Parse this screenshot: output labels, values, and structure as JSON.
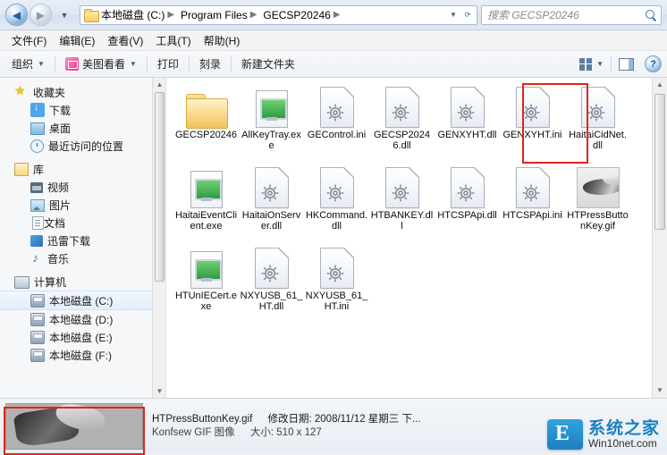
{
  "titlebar": {
    "back_icon": "back-arrow-icon",
    "forward_icon": "forward-arrow-icon",
    "recent_icon": "recent-pages-icon",
    "breadcrumb": [
      "本地磁盘 (C:)",
      "Program Files",
      "GECSP20246"
    ],
    "breadcrumb_separator": "▶",
    "address_dropdown_icon": "chevron-down-icon",
    "refresh_icon": "refresh-icon",
    "search_placeholder": "搜索 GECSP20246",
    "search_value": "",
    "search_icon": "search-icon"
  },
  "menubar": {
    "items": [
      "文件(F)",
      "编辑(E)",
      "查看(V)",
      "工具(T)",
      "帮助(H)"
    ]
  },
  "toolbar": {
    "organize": "组织",
    "meitu": "美图看看",
    "print": "打印",
    "burn": "刻录",
    "new_folder": "新建文件夹",
    "view_icon": "view-layout-icon",
    "preview_pane_icon": "preview-pane-icon",
    "help_icon": "help-icon",
    "caret": "▼"
  },
  "sidebar": {
    "groups": [
      {
        "title": "收藏夹",
        "icon": "favorites-star-icon",
        "items": [
          {
            "label": "下载",
            "icon": "downloads-icon"
          },
          {
            "label": "桌面",
            "icon": "desktop-icon"
          },
          {
            "label": "最近访问的位置",
            "icon": "recent-places-icon"
          }
        ]
      },
      {
        "title": "库",
        "icon": "library-icon",
        "items": [
          {
            "label": "视频",
            "icon": "videos-icon"
          },
          {
            "label": "图片",
            "icon": "pictures-icon"
          },
          {
            "label": "文档",
            "icon": "documents-icon"
          },
          {
            "label": "迅雷下载",
            "icon": "thunder-download-icon"
          },
          {
            "label": "音乐",
            "icon": "music-icon"
          }
        ]
      },
      {
        "title": "计算机",
        "icon": "computer-icon",
        "items": [
          {
            "label": "本地磁盘 (C:)",
            "icon": "disk-icon",
            "selected": true
          },
          {
            "label": "本地磁盘 (D:)",
            "icon": "disk-icon",
            "selected": false
          },
          {
            "label": "本地磁盘 (E:)",
            "icon": "disk-icon",
            "selected": false
          },
          {
            "label": "本地磁盘 (F:)",
            "icon": "disk-icon",
            "selected": false
          }
        ]
      }
    ]
  },
  "files": [
    {
      "name": "GECSP20246",
      "type": "folder",
      "selected": false
    },
    {
      "name": "AllKeyTray.exe",
      "type": "exe",
      "selected": false
    },
    {
      "name": "GEControl.ini",
      "type": "ini",
      "selected": false
    },
    {
      "name": "GECSP20246.dll",
      "type": "dll",
      "selected": false
    },
    {
      "name": "GENXYHT.dll",
      "type": "dll",
      "selected": false
    },
    {
      "name": "GENXYHT.ini",
      "type": "ini",
      "selected": false
    },
    {
      "name": "HaitaiCidNet.dll",
      "type": "dll",
      "selected": false
    },
    {
      "name": "HaitaiEventClient.exe",
      "type": "exe",
      "selected": false
    },
    {
      "name": "HaitaiOnServer.dll",
      "type": "dll",
      "selected": false
    },
    {
      "name": "HKCommand.dll",
      "type": "dll",
      "selected": false
    },
    {
      "name": "HTBANKEY.dll",
      "type": "dll",
      "selected": false
    },
    {
      "name": "HTCSPApi.dll",
      "type": "dll",
      "selected": false
    },
    {
      "name": "HTCSPApi.ini",
      "type": "ini",
      "selected": false
    },
    {
      "name": "HTPressButtonKey.gif",
      "type": "gif",
      "selected": true
    },
    {
      "name": "HTUnIECert.exe",
      "type": "exe",
      "selected": false
    },
    {
      "name": "NXYUSB_61_HT.dll",
      "type": "dll",
      "selected": false
    },
    {
      "name": "NXYUSB_61_HT.ini",
      "type": "ini",
      "selected": false
    }
  ],
  "details": {
    "filename": "HTPressButtonKey.gif",
    "modified_label": "修改日期:",
    "modified_value": "2008/11/12 星期三 下...",
    "type_line": "Konfsew GIF 图像",
    "dimensions_label": "大小:",
    "dimensions_value": "510 x 127"
  },
  "watermark": {
    "brand": "系统之家",
    "site": "Win10net.com",
    "badge_letter": "E"
  },
  "scrollbars": {
    "up_arrow": "▲",
    "down_arrow": "▼"
  }
}
